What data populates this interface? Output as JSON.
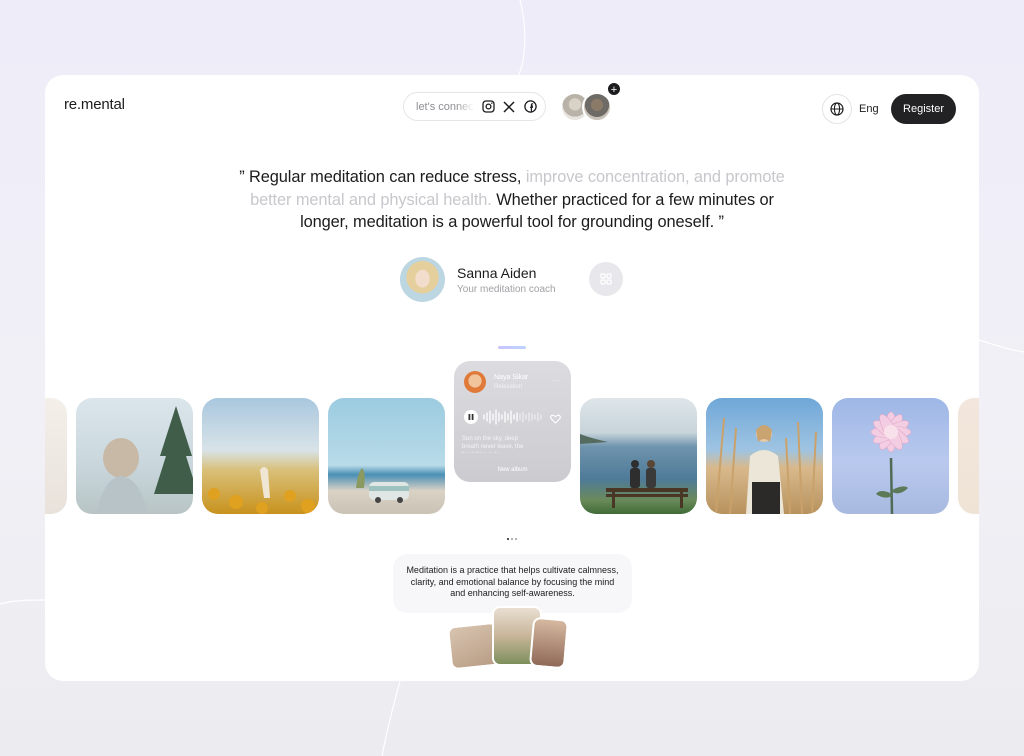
{
  "brand": {
    "logo": "re.mental"
  },
  "header": {
    "connect_label": "let's connect",
    "social_icons": [
      "instagram-icon",
      "x-icon",
      "facebook-icon"
    ],
    "avatars_plus": "+",
    "language": "Eng",
    "register_label": "Register"
  },
  "quote": {
    "part1": "” Regular meditation can reduce stress,",
    "part2_muted": " improve concentration, and promote better mental and physical health.",
    "part3": " Whether practiced for a few minutes or longer, meditation is a powerful tool for grounding oneself. ”"
  },
  "coach": {
    "name": "Sanna Aiden",
    "role": "Your meditation coach"
  },
  "player": {
    "artist": "Naya Sikar",
    "track": "Relaxation",
    "lyrics": "Sun on the sky, deep breath never leave, the hard time is to",
    "footer": "New album"
  },
  "description": "Meditation is a practice that helps cultivate calmness, clarity, and emotional balance by focusing the mind and enhancing self-awareness.",
  "colors": {
    "accent": "#222224",
    "muted_text": "#c7c7cc",
    "background": "#efeef6"
  }
}
